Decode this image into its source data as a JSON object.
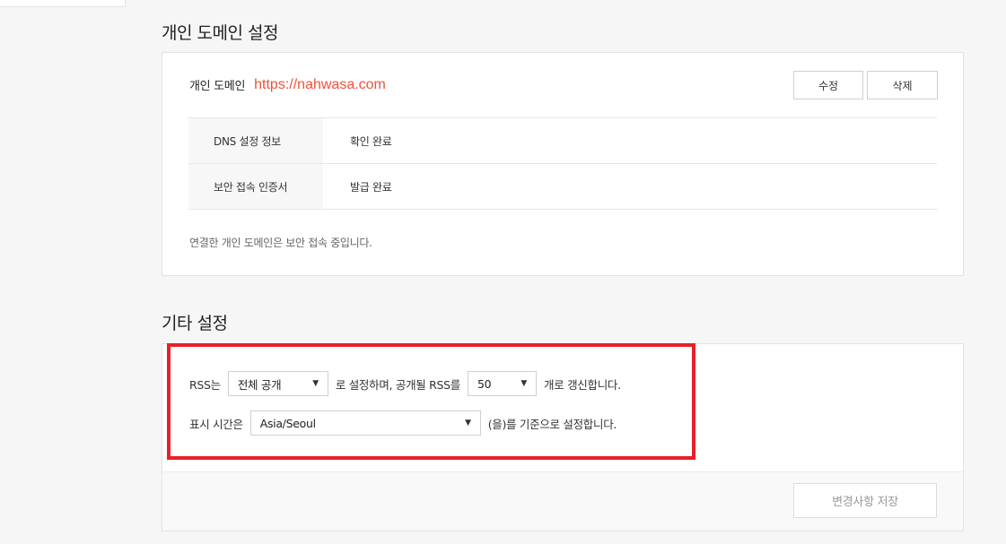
{
  "domain_section": {
    "title": "개인 도메인 설정",
    "domain_label": "개인 도메인",
    "domain_url": "https://nahwasa.com",
    "edit_label": "수정",
    "delete_label": "삭제",
    "rows": [
      {
        "key": "DNS 설정 정보",
        "value": "확인 완료"
      },
      {
        "key": "보안 접속 인증서",
        "value": "발급 완료"
      }
    ],
    "note": "연결한 개인 도메인은 보안 접속 중입니다."
  },
  "other_section": {
    "title": "기타 설정",
    "rss_prefix": "RSS는",
    "rss_visibility": "전체 공개",
    "rss_middle": "로 설정하며, 공개될 RSS를",
    "rss_count": "50",
    "rss_suffix": "개로 갱신합니다.",
    "time_prefix": "표시 시간은",
    "timezone": "Asia/Seoul",
    "time_suffix": "(을)를 기준으로 설정합니다.",
    "save_label": "변경사항 저장"
  },
  "colors": {
    "url": "#f0513b",
    "highlight": "#e8202a"
  }
}
